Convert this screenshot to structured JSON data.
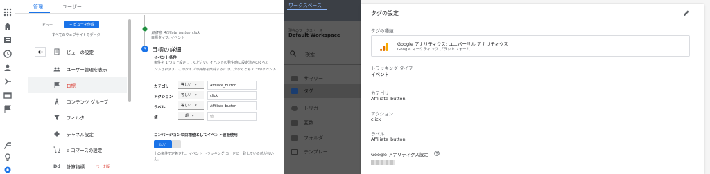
{
  "ga": {
    "tabs": [
      "管理",
      "ユーザー"
    ],
    "view": {
      "label": "ビュー",
      "create_button": "+ ビューを作成",
      "selected": "すべてのウェブサイトのデータ"
    },
    "menu": [
      {
        "label": "ビューの設定",
        "icon": "document-icon"
      },
      {
        "label": "ユーザー管理を表示",
        "icon": "users-icon"
      },
      {
        "label": "目標",
        "icon": "flag-icon",
        "active": true
      },
      {
        "label": "コンテンツ グループ",
        "icon": "person-walk-icon"
      },
      {
        "label": "フィルタ",
        "icon": "filter-icon"
      },
      {
        "label": "チャネル設定",
        "icon": "channel-icon"
      },
      {
        "label": "e コマースの設定",
        "icon": "cart-icon"
      },
      {
        "label": "計算指標",
        "icon": "dd-icon",
        "badge": "ベータ版"
      }
    ],
    "goal": {
      "prev_name": "目標名: Affiliate_button_click",
      "prev_type": "目標タイプ: イベント",
      "step_number": "3",
      "step_title": "目標の詳細",
      "event_conditions": "イベント条件",
      "desc1": "条件を 1 つ以上設定してください。イベントの発生時に設定済みのすべて",
      "desc2": "ントされます。このタイプの目標を作成するには、少なくとも 1 つのイベント",
      "rows": [
        {
          "label": "カテゴリ",
          "op": "等しい",
          "value": "Affiliate_button"
        },
        {
          "label": "アクション",
          "op": "等しい",
          "value": "click"
        },
        {
          "label": "ラベル",
          "op": "等しい",
          "value": "Affiliate_button"
        },
        {
          "label": "値",
          "op": "超",
          "value": "値"
        }
      ],
      "use_value_title": "コンバージョンの目標値としてイベント値を使用",
      "toggle": "はい",
      "note1": "上の条件で定義され、イベント トラッキング コードに一致している値がない",
      "note2": "ん。"
    }
  },
  "gtm": {
    "header": "ワークスペース",
    "current_label": "現在のワークスペース",
    "workspace": "Default Workspace",
    "search": "検索",
    "nav": [
      "サマリー",
      "タグ",
      "トリガー",
      "変数",
      "フォルダ",
      "テンプレー"
    ]
  },
  "tag": {
    "title": "タグの設定",
    "type_label": "タグの種類",
    "type_name": "Google アナリティクス: ユニバーサル アナリティクス",
    "type_sub": "Google マーケティング プラットフォーム",
    "tracking_label": "トラッキング タイプ",
    "tracking_value": "イベント",
    "category_label": "カテゴリ",
    "category_value": "Affiliate_button",
    "action_label": "アクション",
    "action_value": "click",
    "label_label": "ラベル",
    "label_value": "Affiliate_button",
    "ga_settings_label": "Google アナリティクス設定"
  },
  "colors": {
    "accent": "#1a73e8",
    "active_red": "#d93025",
    "ga_orange": "#f9ab00",
    "ga_orange_dark": "#e37400"
  }
}
